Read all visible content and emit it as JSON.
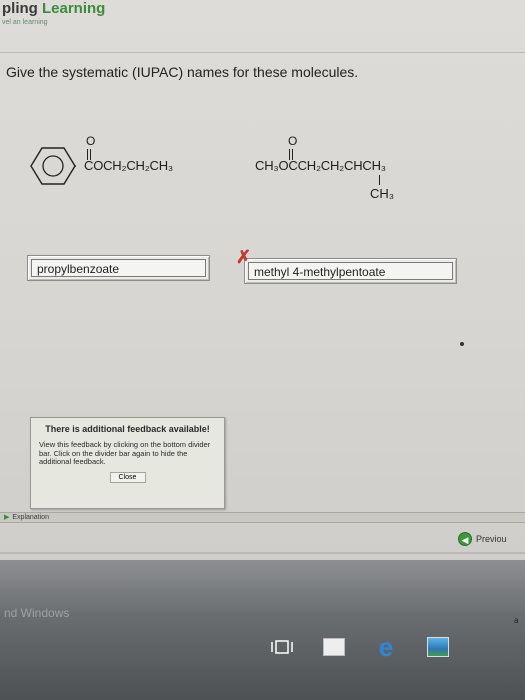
{
  "header": {
    "brand_prefix": "pling ",
    "brand_learning": "Learning",
    "brand_tagline": "vel an learning"
  },
  "question": {
    "text": "Give the systematic (IUPAC) names for these molecules."
  },
  "molecules": [
    {
      "carbonyl_o": "O",
      "chain": "COCH₂CH₂CH₃"
    },
    {
      "carbonyl_o": "O",
      "chain": "CH₃OCCH₂CH₂CHCH₃",
      "branch": "CH₃"
    }
  ],
  "answers": [
    {
      "value": "propylbenzoate"
    },
    {
      "value": "methyl 4-methylpentoate",
      "status_mark": "✗"
    }
  ],
  "feedback": {
    "title": "There is additional feedback available!",
    "body": "View this feedback by clicking on the bottom divider bar. Click on the divider bar again to hide the additional feedback.",
    "close_label": "Close"
  },
  "divider": {
    "explanation_label": "Explanation"
  },
  "nav": {
    "previous_label": "Previou"
  },
  "desktop": {
    "watermark": "nd Windows",
    "side_mark": "a"
  },
  "colors": {
    "brand_green": "#3d8b3d",
    "error_red": "#c23a2c",
    "nav_green": "#3a9a3a"
  }
}
